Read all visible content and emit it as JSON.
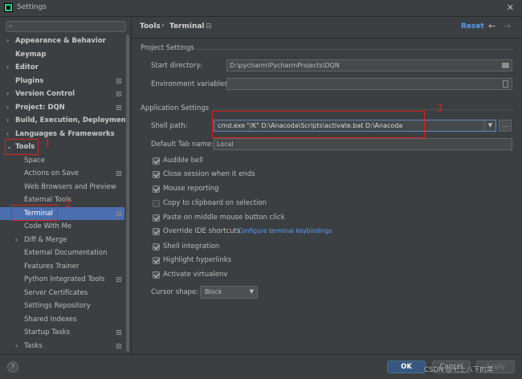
{
  "window": {
    "title": "Settings",
    "close_glyph": "✕"
  },
  "search": {
    "placeholder": "",
    "icon": "search-icon"
  },
  "sidebar": {
    "items": [
      {
        "label": "Appearance & Behavior",
        "bold": true,
        "arrow": "›",
        "level": 0,
        "icon": false
      },
      {
        "label": "Keymap",
        "bold": true,
        "arrow": "",
        "level": 0,
        "icon": false
      },
      {
        "label": "Editor",
        "bold": true,
        "arrow": "›",
        "level": 0,
        "icon": false
      },
      {
        "label": "Plugins",
        "bold": true,
        "arrow": "",
        "level": 0,
        "icon": true
      },
      {
        "label": "Version Control",
        "bold": true,
        "arrow": "›",
        "level": 0,
        "icon": true
      },
      {
        "label": "Project: DQN",
        "bold": true,
        "arrow": "›",
        "level": 0,
        "icon": true
      },
      {
        "label": "Build, Execution, Deployment",
        "bold": true,
        "arrow": "›",
        "level": 0,
        "icon": false
      },
      {
        "label": "Languages & Frameworks",
        "bold": true,
        "arrow": "›",
        "level": 0,
        "icon": false
      },
      {
        "label": "Tools",
        "bold": true,
        "arrow": "⌄",
        "level": 0,
        "icon": false
      },
      {
        "label": "Space",
        "bold": false,
        "arrow": "",
        "level": 1,
        "icon": false
      },
      {
        "label": "Actions on Save",
        "bold": false,
        "arrow": "",
        "level": 1,
        "icon": true
      },
      {
        "label": "Web Browsers and Preview",
        "bold": false,
        "arrow": "",
        "level": 1,
        "icon": false
      },
      {
        "label": "External Tools",
        "bold": false,
        "arrow": "",
        "level": 1,
        "icon": false
      },
      {
        "label": "Terminal",
        "bold": false,
        "arrow": "",
        "level": 1,
        "icon": true,
        "selected": true
      },
      {
        "label": "Code With Me",
        "bold": false,
        "arrow": "",
        "level": 1,
        "icon": false
      },
      {
        "label": "Diff & Merge",
        "bold": false,
        "arrow": "›",
        "level": 1,
        "icon": false
      },
      {
        "label": "External Documentation",
        "bold": false,
        "arrow": "",
        "level": 1,
        "icon": false
      },
      {
        "label": "Features Trainer",
        "bold": false,
        "arrow": "",
        "level": 1,
        "icon": false
      },
      {
        "label": "Python Integrated Tools",
        "bold": false,
        "arrow": "",
        "level": 1,
        "icon": true
      },
      {
        "label": "Server Certificates",
        "bold": false,
        "arrow": "",
        "level": 1,
        "icon": false
      },
      {
        "label": "Settings Repository",
        "bold": false,
        "arrow": "",
        "level": 1,
        "icon": false
      },
      {
        "label": "Shared Indexes",
        "bold": false,
        "arrow": "",
        "level": 1,
        "icon": false
      },
      {
        "label": "Startup Tasks",
        "bold": false,
        "arrow": "",
        "level": 1,
        "icon": true
      },
      {
        "label": "Tasks",
        "bold": false,
        "arrow": "›",
        "level": 1,
        "icon": true
      }
    ]
  },
  "header": {
    "breadcrumb_1": "Tools",
    "breadcrumb_sep": "›",
    "breadcrumb_2": "Terminal",
    "breadcrumb_icon": "⊟",
    "reset": "Reset",
    "back_glyph": "←",
    "forward_glyph": "→"
  },
  "project_settings": {
    "title": "Project Settings",
    "start_dir_label": "Start directory:",
    "start_dir_value": "D:\\pycharm\\PycharmProjects\\DQN",
    "env_label": "Environment variables:",
    "env_value": ""
  },
  "app_settings": {
    "title": "Application Settings",
    "shell_label": "Shell path:",
    "shell_value": "cmd.exe \"/K\" D:\\Anacoda\\Scripts\\activate.bat D:\\Anacoda",
    "dd_glyph": "▼",
    "dots_glyph": "...",
    "tab_name_label": "Default Tab name:",
    "tab_name_value": "Local",
    "checkboxes": [
      {
        "label": "Audible bell",
        "checked": true
      },
      {
        "label": "Close session when it ends",
        "checked": true
      },
      {
        "label": "Mouse reporting",
        "checked": true
      },
      {
        "label": "Copy to clipboard on selection",
        "checked": false
      },
      {
        "label": "Paste on middle mouse button click",
        "checked": true
      },
      {
        "label": "Override IDE shortcuts",
        "checked": true,
        "link": "Configure terminal keybindings"
      },
      {
        "label": "Shell integration",
        "checked": true
      },
      {
        "label": "Highlight hyperlinks",
        "checked": true
      },
      {
        "label": "Activate virtualenv",
        "checked": true
      }
    ],
    "cursor_label": "Cursor shape:",
    "cursor_value": "Block",
    "cursor_arrow": "▼"
  },
  "footer": {
    "help": "?",
    "ok": "OK",
    "cancel": "Cancel",
    "apply": "Apply",
    "watermark": "CSDN @七上八下的黑"
  },
  "annotations": {
    "n1": "1",
    "n2": "2",
    "n3": "3",
    "color": "#e02020"
  },
  "colors": {
    "selection": "#4b6eaf",
    "link": "#589df6",
    "bg": "#3c3f41"
  }
}
